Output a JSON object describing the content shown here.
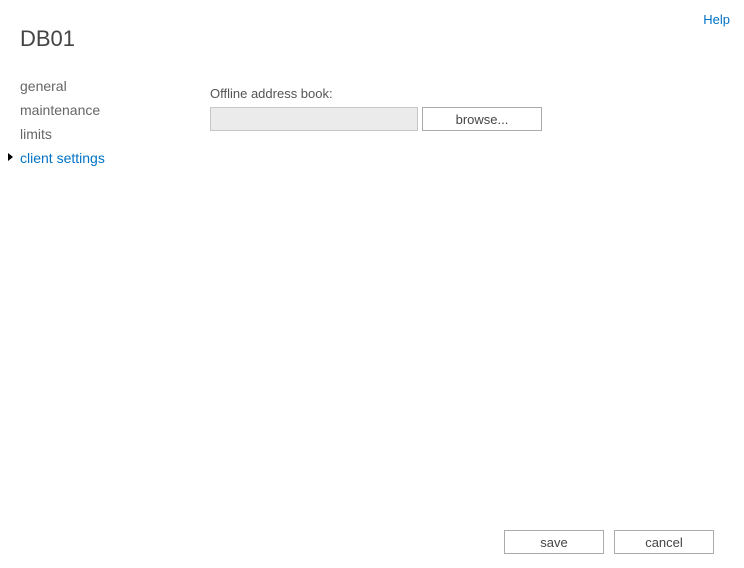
{
  "help_link": "Help",
  "page_title": "DB01",
  "nav": {
    "items": [
      {
        "label": "general"
      },
      {
        "label": "maintenance"
      },
      {
        "label": "limits"
      },
      {
        "label": "client settings"
      }
    ],
    "active_index": 3
  },
  "content": {
    "oab_label": "Offline address book:",
    "oab_value": "",
    "browse_label": "browse..."
  },
  "footer": {
    "save_label": "save",
    "cancel_label": "cancel"
  }
}
